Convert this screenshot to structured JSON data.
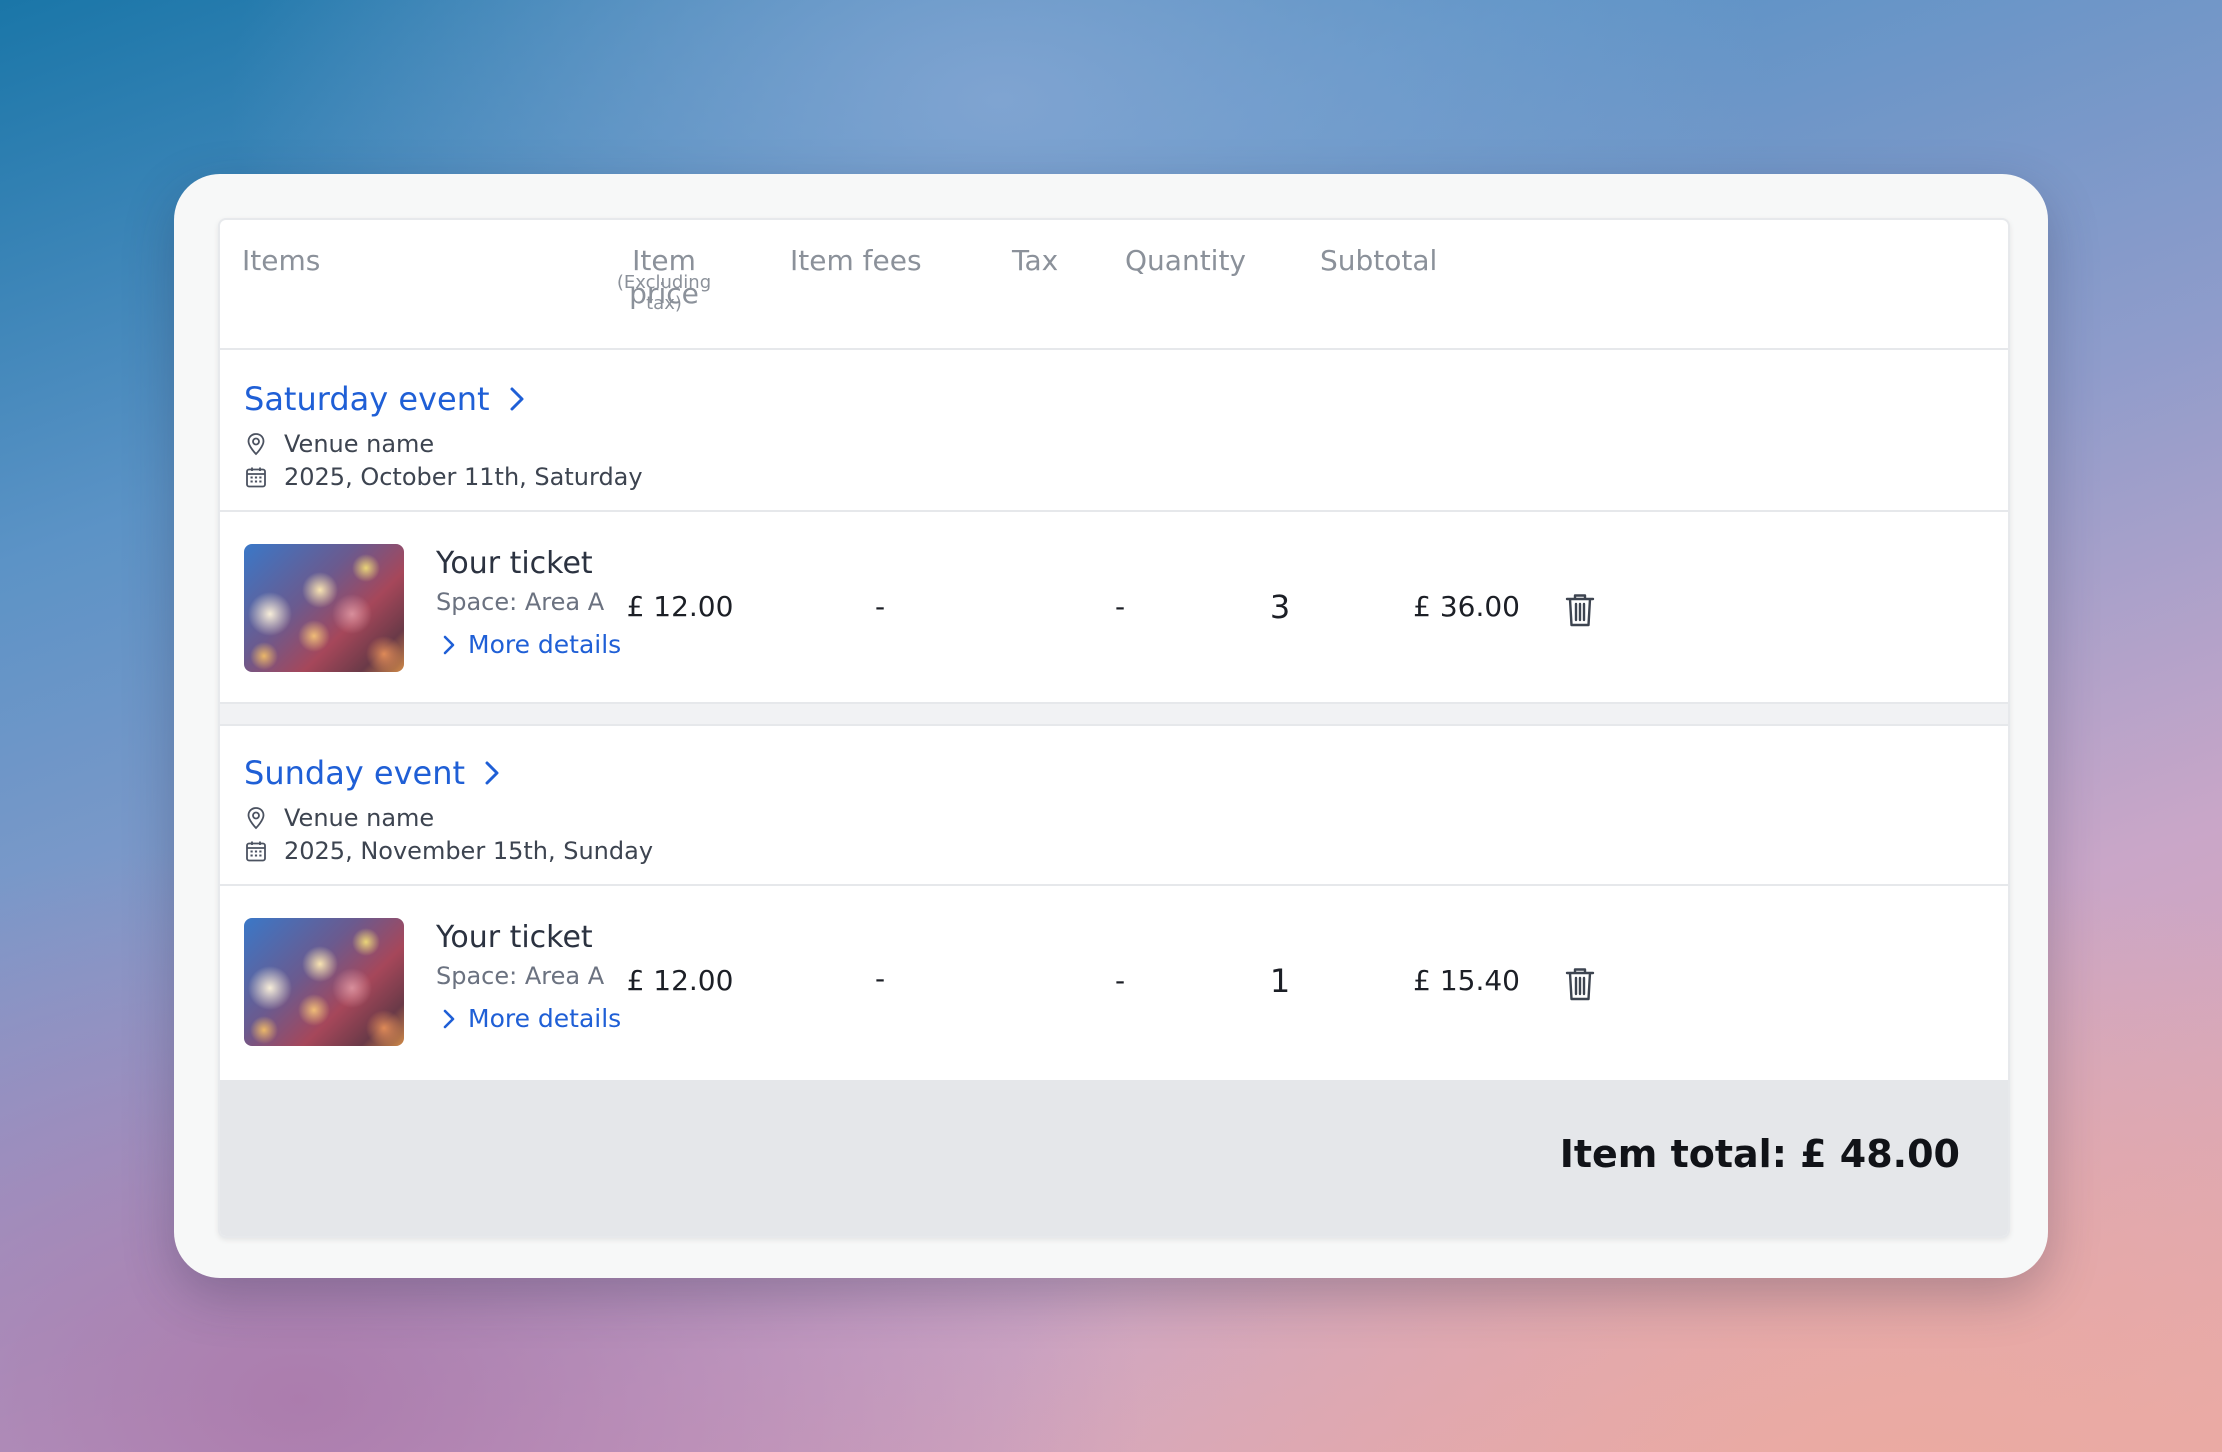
{
  "header": {
    "items": "Items",
    "item_price": "Item price",
    "item_price_note": "(Excluding tax)",
    "item_fees": "Item fees",
    "tax": "Tax",
    "quantity": "Quantity",
    "subtotal": "Subtotal"
  },
  "events": [
    {
      "title": "Saturday event",
      "venue": "Venue name",
      "date": "2025, October 11th, Saturday",
      "ticket": {
        "name": "Your ticket",
        "space": "Space: Area A",
        "more": "More details",
        "price": "£ 12.00",
        "fees": "-",
        "tax": "-",
        "quantity": "3",
        "subtotal": "£ 36.00"
      }
    },
    {
      "title": "Sunday event",
      "venue": "Venue name",
      "date": "2025, November 15th, Sunday",
      "ticket": {
        "name": "Your ticket",
        "space": "Space: Area A",
        "more": "More details",
        "price": "£ 12.00",
        "fees": "-",
        "tax": "-",
        "quantity": "1",
        "subtotal": "£ 15.40"
      }
    }
  ],
  "footer": {
    "total": "Item total: £ 48.00"
  },
  "colors": {
    "link": "#1f5fd6",
    "header_text": "#8b919a",
    "footer_bg": "#e5e7ea"
  },
  "icons": [
    "location-pin-icon",
    "calendar-icon",
    "chevron-right-icon",
    "trash-icon"
  ]
}
